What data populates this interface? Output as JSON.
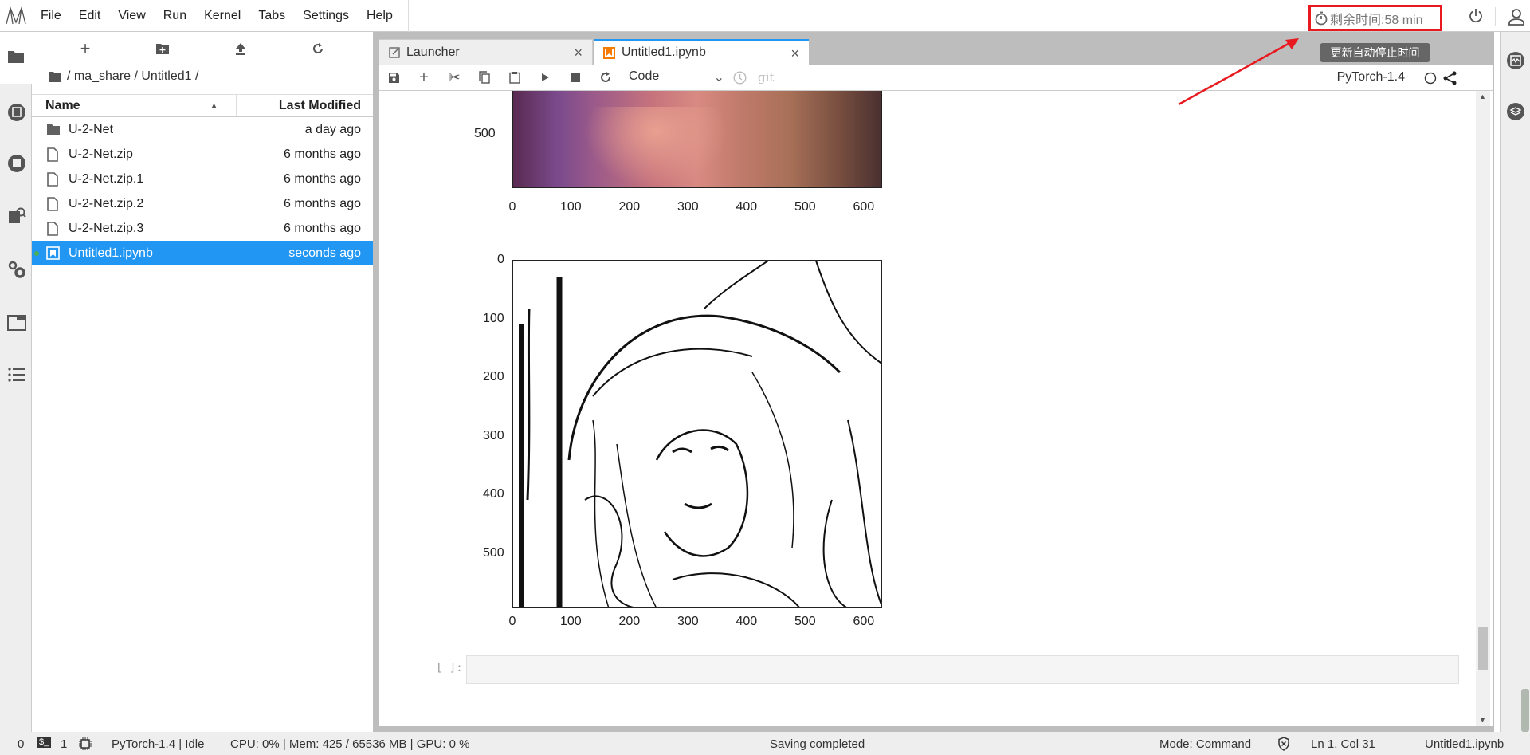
{
  "menubar": {
    "items": [
      "File",
      "Edit",
      "View",
      "Run",
      "Kernel",
      "Tabs",
      "Settings",
      "Help"
    ],
    "timer": "剩余时间:58 min",
    "timer_tooltip": "更新自动停止时间"
  },
  "filebrowser": {
    "breadcrumb": "/ ma_share / Untitled1 /",
    "col_name": "Name",
    "col_modified": "Last Modified",
    "files": [
      {
        "name": "U-2-Net",
        "modified": "a day ago",
        "type": "folder"
      },
      {
        "name": "U-2-Net.zip",
        "modified": "6 months ago",
        "type": "file"
      },
      {
        "name": "U-2-Net.zip.1",
        "modified": "6 months ago",
        "type": "file"
      },
      {
        "name": "U-2-Net.zip.2",
        "modified": "6 months ago",
        "type": "file"
      },
      {
        "name": "U-2-Net.zip.3",
        "modified": "6 months ago",
        "type": "file"
      },
      {
        "name": "Untitled1.ipynb",
        "modified": "seconds ago",
        "type": "notebook",
        "selected": true,
        "running": true
      }
    ]
  },
  "tabs": [
    {
      "label": "Launcher"
    },
    {
      "label": "Untitled1.ipynb",
      "active": true
    }
  ],
  "toolbar": {
    "cell_type": "Code",
    "git": "git",
    "kernel": "PyTorch-1.4"
  },
  "notebook": {
    "plot1": {
      "y_ticks": [
        "500"
      ],
      "x_ticks": [
        "0",
        "100",
        "200",
        "300",
        "400",
        "500",
        "600"
      ]
    },
    "plot2": {
      "y_ticks": [
        "0",
        "100",
        "200",
        "300",
        "400",
        "500"
      ],
      "x_ticks": [
        "0",
        "100",
        "200",
        "300",
        "400",
        "500",
        "600"
      ]
    },
    "empty_prompt": "[ ]:"
  },
  "statusbar": {
    "terminals": "0",
    "kernels": "1",
    "kernel_status": "PyTorch-1.4 | Idle",
    "resources": "CPU: 0% | Mem: 425 / 65536 MB | GPU: 0 %",
    "message": "Saving completed",
    "mode": "Mode: Command",
    "position": "Ln 1, Col 31",
    "filename": "Untitled1.ipynb"
  },
  "colors": {
    "accent": "#2196f3",
    "highlight": "#e8191f",
    "notebook_icon": "#f57c00"
  }
}
